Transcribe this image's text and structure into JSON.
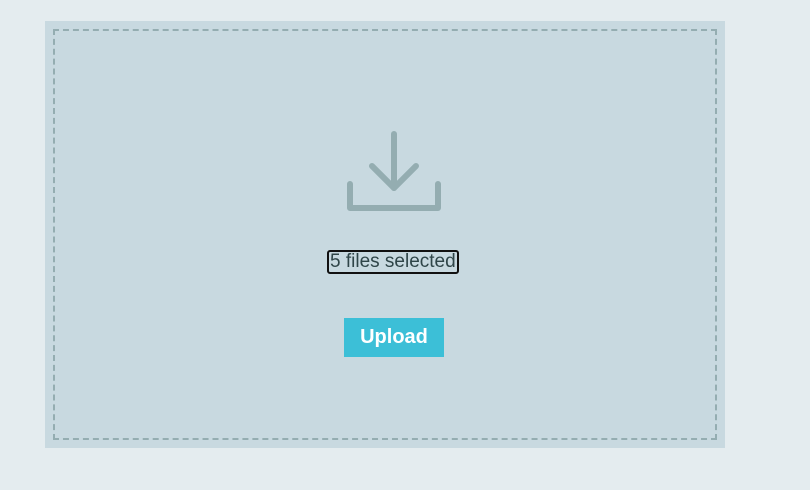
{
  "upload": {
    "icon": "download-icon",
    "file_status": "5 files selected",
    "upload_label": "Upload"
  },
  "colors": {
    "page_background": "#e4ecef",
    "box_background": "#c8d9e0",
    "border_dash": "#94adb1",
    "icon": "#94adb1",
    "button_background": "#3cbfd7",
    "button_text": "#ffffff",
    "label_text": "#2f4548"
  }
}
